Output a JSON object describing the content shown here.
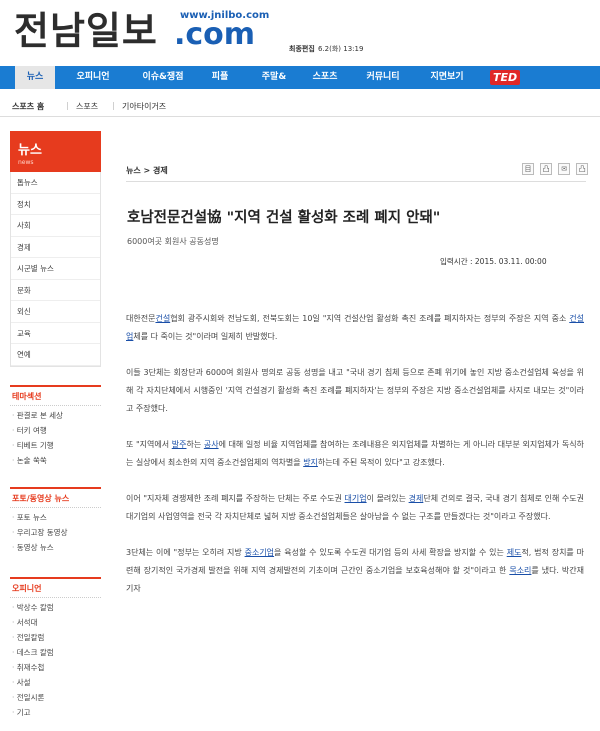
{
  "header": {
    "logo_text": "전남일보",
    "url_small": "www.jnilbo.com",
    "url_com": ".com",
    "edited_label": "최종편집",
    "edited_value": "6.2(화) 13:19"
  },
  "nav": {
    "items": [
      "뉴스",
      "오피니언",
      "이슈&쟁점",
      "피플",
      "주말&",
      "스포츠",
      "커뮤니티",
      "지면보기"
    ],
    "ted": "TED"
  },
  "breadcrumb": {
    "items": [
      "스포츠 홈",
      "스포츠",
      "기아타이거즈"
    ]
  },
  "sidebar": {
    "title": "뉴스",
    "subtitle": "news",
    "items": [
      "톱뉴스",
      "정치",
      "사회",
      "경제",
      "시군별 뉴스",
      "문화",
      "외신",
      "교육",
      "연예"
    ],
    "theme": {
      "title": "테마섹션",
      "items": [
        "판결로 본 세상",
        "터키 여행",
        "티베트 기행",
        "논술 쑥쑥"
      ]
    },
    "photo": {
      "title": "포토/동영상 뉴스",
      "items": [
        "포토 뉴스",
        "우리고장 동영상",
        "동영상 뉴스"
      ]
    },
    "opinion": {
      "title": "오피니언",
      "items": [
        "박상수 칼럼",
        "서석대",
        "전일칼럼",
        "데스크 칼럼",
        "취재수첩",
        "사설",
        "전일시론",
        "기고"
      ]
    }
  },
  "article": {
    "crumb": "뉴스 > 경제",
    "tools": [
      "目",
      "凸",
      "✉",
      "凸"
    ],
    "headline": "호남전문건설協 \"지역 건설 활성화 조례 폐지 안돼\"",
    "subhead": "6000여곳 회원사 공동성명",
    "date": "입력시간 : 2015. 03.11. 00:00",
    "paragraphs": [
      [
        {
          "t": "대한전문"
        },
        {
          "t": "건설",
          "link": true
        },
        {
          "t": "협회 광주시회와 전남도회, 전북도회는 10일 \"지역 건설산업 활성화 촉진 조례를 폐지하자는 정부의 주장은 지역 중소 "
        },
        {
          "t": "건설업",
          "link": true
        },
        {
          "t": "체를 다 죽이는 것\"이라며 일제히 반발했다."
        }
      ],
      [
        {
          "t": "이들 3단체는 회장단과 6000여 회원사 명의로 공동 성명을 내고 \"국내 경기 침체 등으로 존폐 위기에 놓인 지방 중소건설업체 육성을 위해 각 자치단체에서 시행중인 '지역 건설경기 활성화 촉진 조례를 폐지하자'는 정부의 주장은 지방 중소건설업체를 사지로 내모는 것\"이라고 주장했다."
        }
      ],
      [
        {
          "t": "또 \"지역에서 "
        },
        {
          "t": "발주",
          "link": true
        },
        {
          "t": "하는 "
        },
        {
          "t": "공사",
          "link": true
        },
        {
          "t": "에 대해 일정 비율 지역업체를 참여하는 조례내용은 외지업체를 차별하는 게 아니라 대부분 외지업체가 독식하는 실상에서 최소한의 지역 중소건설업체의 역차별을 "
        },
        {
          "t": "방지",
          "link": true
        },
        {
          "t": "하는데 주된 목적이 있다\"고 강조했다."
        }
      ],
      [
        {
          "t": "이어 \"지자체 경쟁제한 조례 폐지를 주장하는 단체는 주로 수도권 "
        },
        {
          "t": "대기업",
          "link": true
        },
        {
          "t": "이 몰려있는 "
        },
        {
          "t": "경제",
          "link": true
        },
        {
          "t": "단체 건의로 결국, 국내 경기 침체로 인해 수도권 대기업의 사업영역을 전국 각 자치단체로 넓혀 지방 중소건설업체들은 살아남을 수 없는 구조를 만들겠다는 것\"이라고 주장했다."
        }
      ],
      [
        {
          "t": "3단체는 이에 \"정부는 오히려 지방 "
        },
        {
          "t": "중소기업",
          "link": true
        },
        {
          "t": "을 육성할 수 있도록 수도권 대기업 등의 사세 확장을 방지할 수 있는 "
        },
        {
          "t": "제도",
          "link": true
        },
        {
          "t": "적, 법적 장치를 마련해 장기적인 국가경제 발전을 위해 지역 경제발전의 기초이며 근간인 중소기업을 보호육성해야 할 것\"이라고 한 "
        },
        {
          "t": "목소리",
          "link": true
        },
        {
          "t": "를 냈다. 박간재 기자"
        }
      ]
    ]
  }
}
